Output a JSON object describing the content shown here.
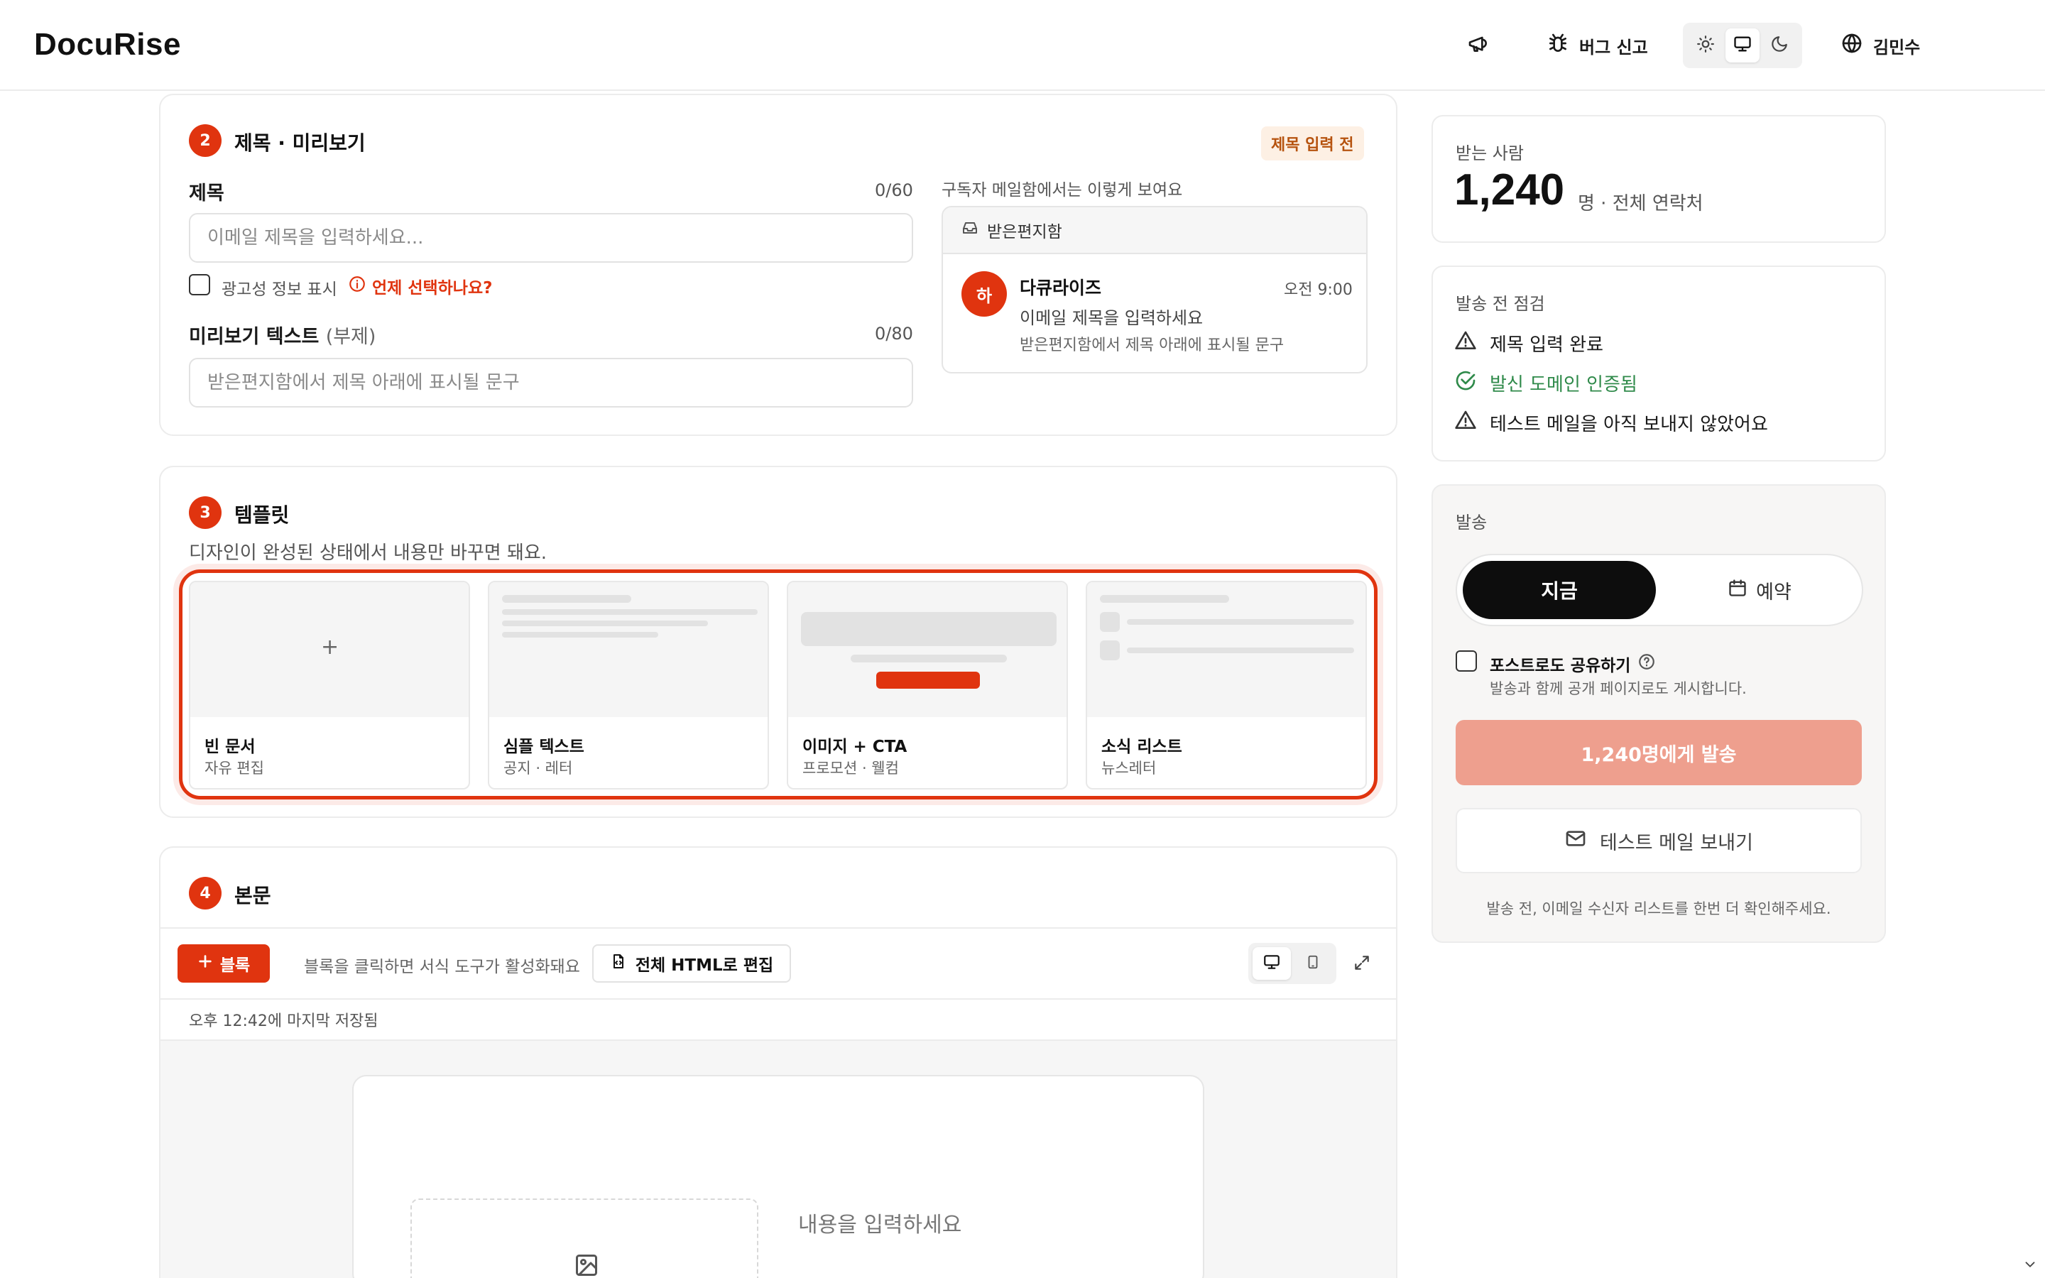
{
  "header": {
    "logo": "DocuRise",
    "bug_report": "버그 신고",
    "user_name": "김민수",
    "theme_options": [
      "light",
      "system",
      "dark"
    ],
    "theme_selected": "system"
  },
  "section2": {
    "step": "2",
    "title": "제목 · 미리보기",
    "status_badge": "제목 입력 전",
    "subject_label": "제목",
    "subject_counter": "0/60",
    "subject_placeholder": "이메일 제목을 입력하세요...",
    "ad_checkbox_label": "광고성 정보 표시",
    "ad_help_link": "언제 선택하나요?",
    "preview_label_main": "미리보기 텍스트",
    "preview_label_sub": "(부제)",
    "preview_counter": "0/80",
    "preview_placeholder": "받은편지함에서 제목 아래에 표시될 문구",
    "inbox_caption": "구독자 메일함에서는 이렇게 보여요",
    "inbox_header": "받은편지함",
    "sender_avatar": "하",
    "sender_name": "다큐라이즈",
    "sent_time": "오전 9:00",
    "mail_subject": "이메일 제목을 입력하세요",
    "mail_preview": "받은편지함에서 제목 아래에 표시될 문구"
  },
  "section3": {
    "step": "3",
    "title": "템플릿",
    "description": "디자인이 완성된 상태에서 내용만 바꾸면 돼요.",
    "templates": [
      {
        "name": "빈 문서",
        "desc": "자유 편집"
      },
      {
        "name": "심플 텍스트",
        "desc": "공지 · 레터"
      },
      {
        "name": "이미지 + CTA",
        "desc": "프로모션 · 웰컴"
      },
      {
        "name": "소식 리스트",
        "desc": "뉴스레터"
      }
    ]
  },
  "section4": {
    "step": "4",
    "title": "본문",
    "add_block": "블록",
    "hint": "블록을 클릭하면 서식 도구가 활성화돼요",
    "edit_html": "전체 HTML로 편집",
    "view_modes": [
      "desktop",
      "mobile"
    ],
    "view_selected": "desktop",
    "saved_status": "오후 12:42에 마지막 저장됨",
    "content_placeholder": "내용을 입력하세요"
  },
  "recipients": {
    "label": "받는 사람",
    "count": "1,240",
    "suffix": "명 · 전체 연락처"
  },
  "checklist": {
    "label": "발송 전 점검",
    "items": [
      {
        "text": "제목 입력 완료",
        "status": "warning"
      },
      {
        "text": "발신 도메인 인증됨",
        "status": "ok"
      },
      {
        "text": "테스트 메일을 아직 보내지 않았어요",
        "status": "warning"
      }
    ]
  },
  "send": {
    "label": "발송",
    "now": "지금",
    "schedule": "예약",
    "share_post_label": "포스트로도 공유하기",
    "share_post_help": "발송과 함께 공개 페이지로도 게시합니다.",
    "send_button": "1,240명에게 발송",
    "test_mail_button": "테스트 메일 보내기",
    "footnote": "발송 전, 이메일 수신자 리스트를 한번 더 확인해주세요."
  },
  "colors": {
    "accent": "#e0340f",
    "send_disabled": "#ee9f8e",
    "ok_green": "#2f8a4a",
    "badge_bg": "#fdf0e4"
  }
}
